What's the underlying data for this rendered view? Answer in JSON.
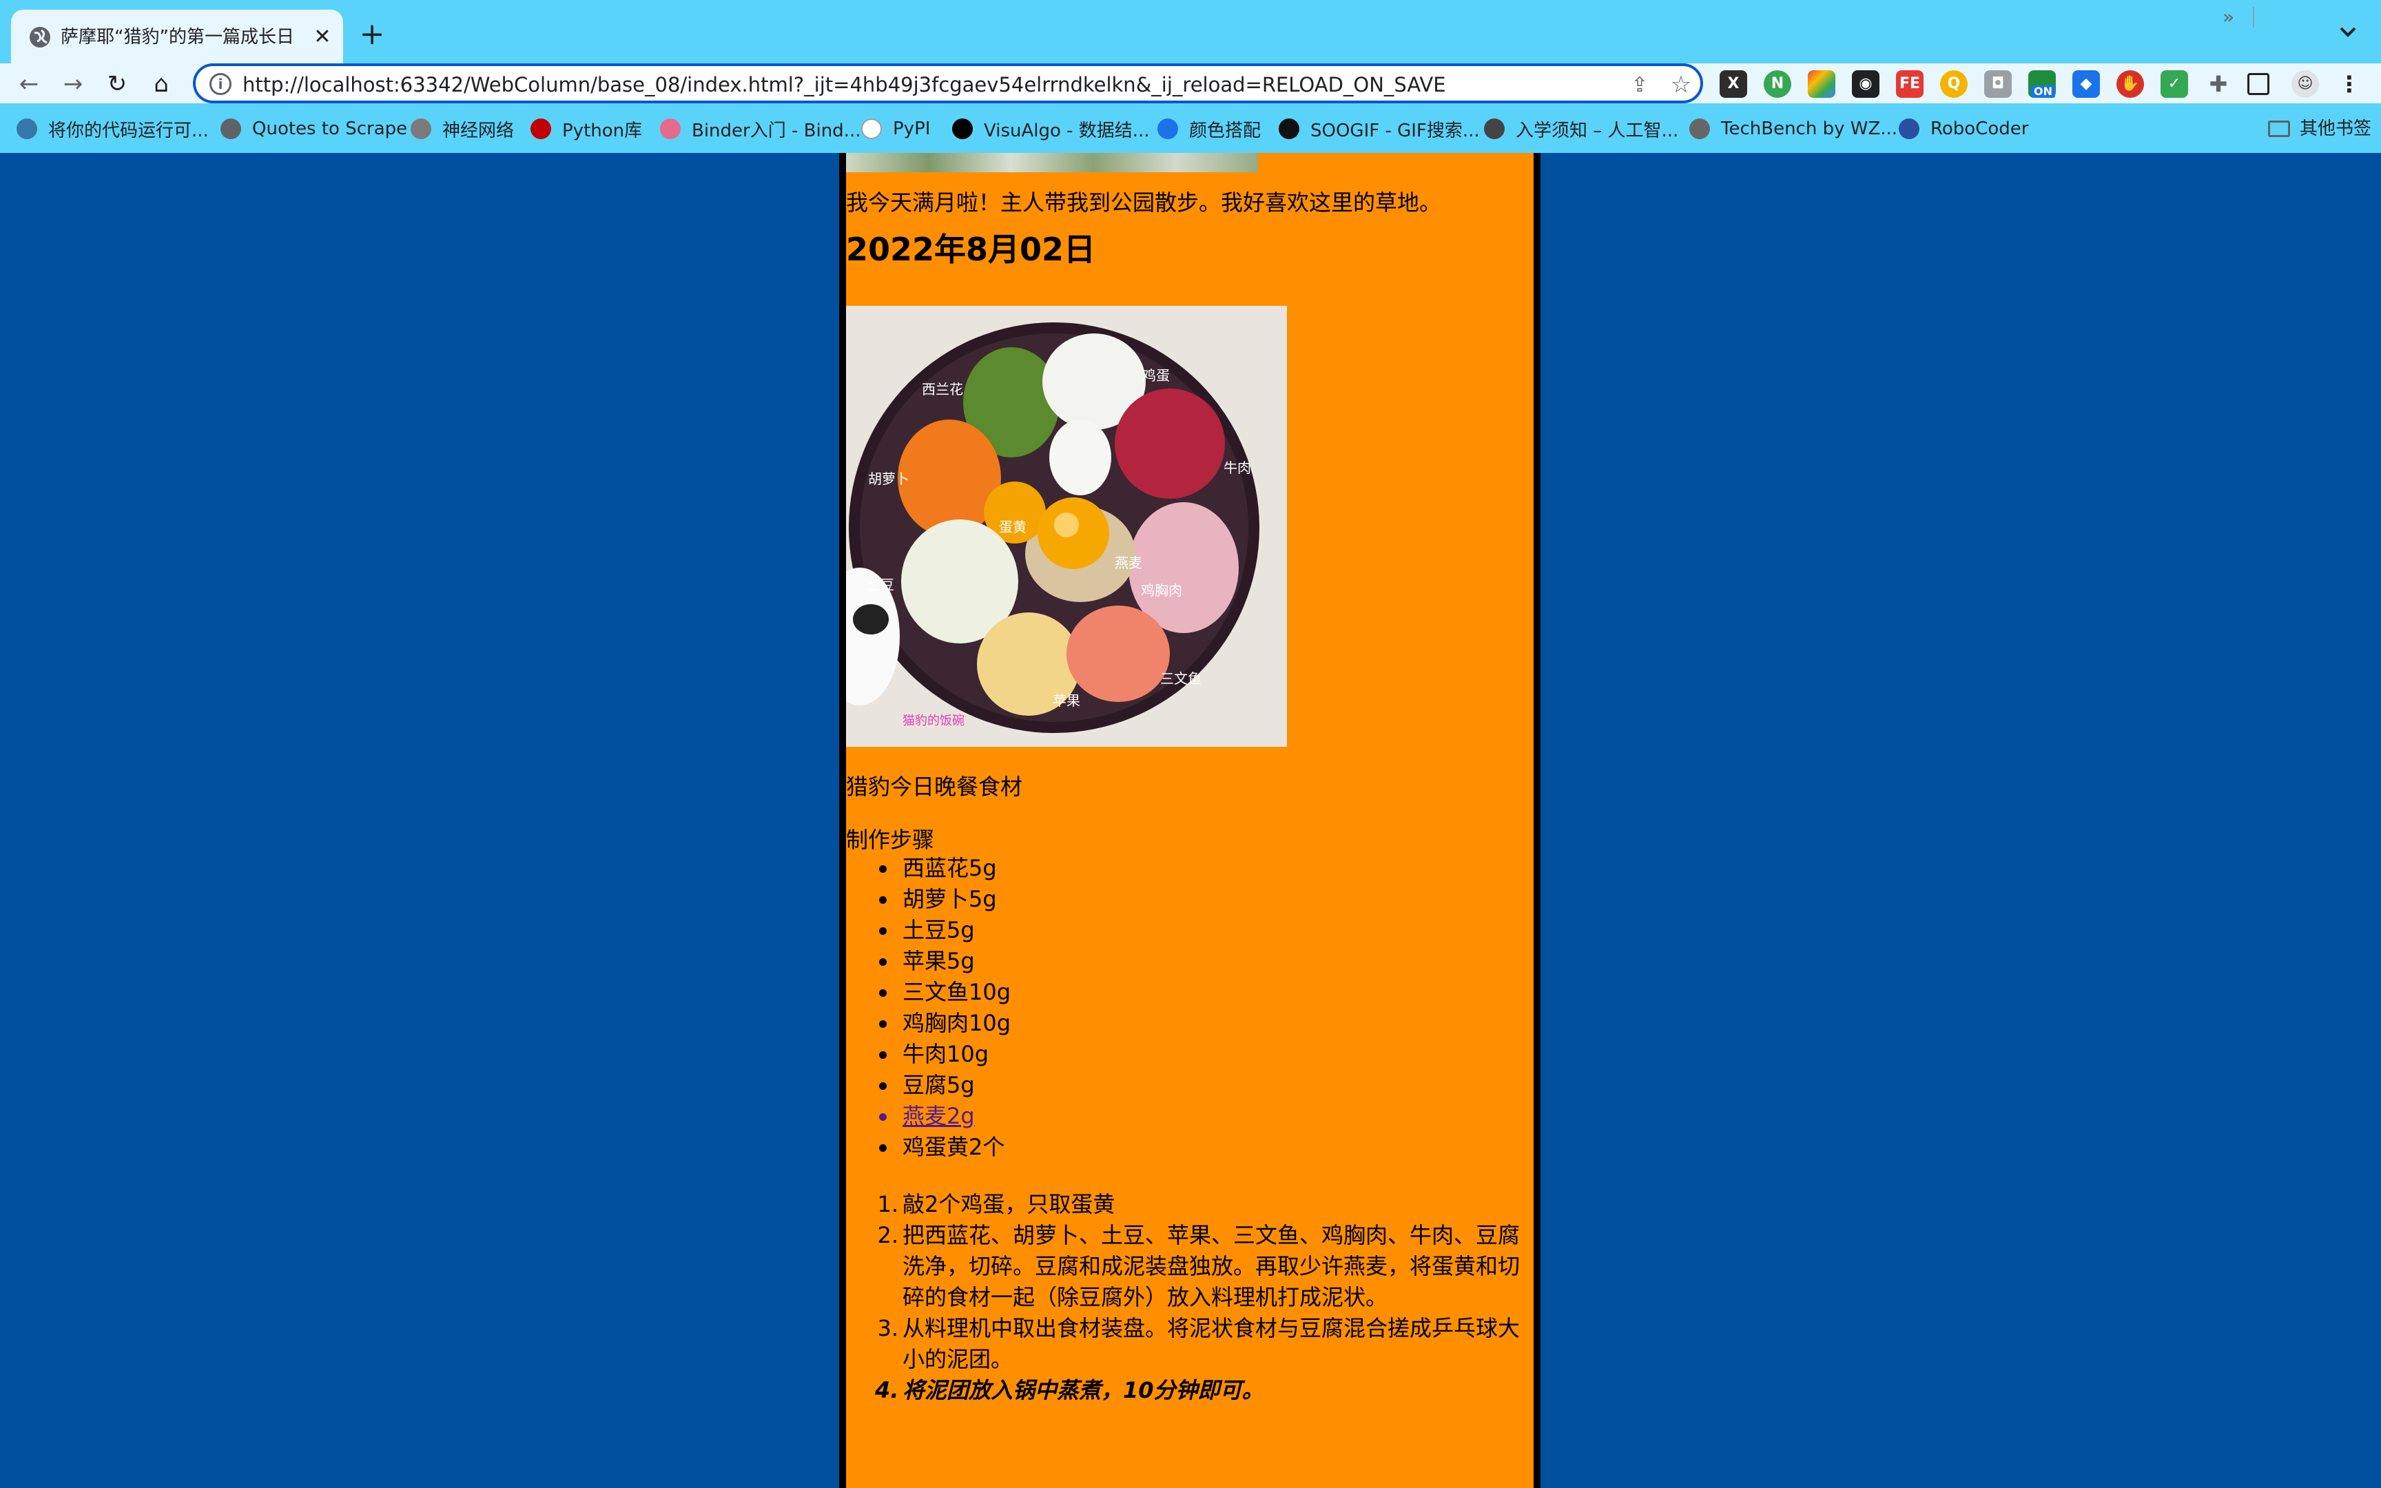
{
  "browser": {
    "tab_title": "萨摩耶“猎豹”的第一篇成长日记",
    "tab_close": "✕",
    "new_tab": "+",
    "url": "http://localhost:63342/WebColumn/base_08/index.html?_ijt=4hb49j3fcgaev54elrrndkelkn&_ij_reload=RELOAD_ON_SAVE",
    "nav": {
      "back": "←",
      "forward": "→",
      "reload": "↻",
      "home": "⌂"
    },
    "bookmarks": [
      {
        "label": "将你的代码运行可...",
        "color": "#3776ab"
      },
      {
        "label": "Quotes to Scrape",
        "color": "#5f6368"
      },
      {
        "label": "神经网络",
        "color": "#7a7a7a"
      },
      {
        "label": "Python库",
        "color": "#c00000"
      },
      {
        "label": "Binder入门 - Bind...",
        "color": "#e66a8a"
      },
      {
        "label": "PyPI",
        "color": "#ffffff"
      },
      {
        "label": "VisuAlgo - 数据结...",
        "color": "#000000"
      },
      {
        "label": "颜色搭配",
        "color": "#1a73e8"
      },
      {
        "label": "SOOGIF - GIF搜索...",
        "color": "#111111"
      },
      {
        "label": "入学须知 – 人工智...",
        "color": "#444444"
      },
      {
        "label": "TechBench by WZ...",
        "color": "#666666"
      },
      {
        "label": "RoboCoder",
        "color": "#2a4fa0"
      }
    ],
    "bookmarks_more": "»",
    "other_bookmarks": "其他书签",
    "extension_on_badge": "ON"
  },
  "page": {
    "intro_text": "我今天满月啦！主人带我到公园散步。我好喜欢这里的草地。",
    "date_heading": "2022年8月02日",
    "image_caption": "猎豹今日晚餐食材",
    "steps_title": "制作步骤",
    "ingredients": [
      "西蓝花5g",
      "胡萝卜5g",
      "土豆5g",
      "苹果5g",
      "三文鱼10g",
      "鸡胸肉10g",
      "牛肉10g",
      "豆腐5g",
      "燕麦2g",
      "鸡蛋黄2个"
    ],
    "link_ingredient_index": 8,
    "steps": [
      "敲2个鸡蛋，只取蛋黄",
      "把西蓝花、胡萝卜、土豆、苹果、三文鱼、鸡胸肉、牛肉、豆腐洗净，切碎。豆腐和成泥装盘独放。再取少许燕麦，将蛋黄和切碎的食材一起（除豆腐外）放入料理机打成泥状。",
      "从料理机中取出食材装盘。将泥状食材与豆腐混合搓成乒乓球大小的泥团。",
      "将泥团放入锅中蒸煮，10分钟即可。"
    ],
    "emphasized_step_index": 3,
    "image_labels": [
      "西兰花",
      "鸡蛋",
      "牛肉",
      "胡萝卜",
      "蛋黄",
      "燕麦",
      "鸡胸肉",
      "土豆",
      "苹果",
      "三文鱼"
    ],
    "image_watermark": "猫豹的饭碗"
  },
  "colors": {
    "page_background": "#01509f",
    "content_background": "#ff8f00",
    "content_border": "#000000",
    "browser_chrome": "#5ad3fa",
    "link_visited": "#551a8b"
  }
}
